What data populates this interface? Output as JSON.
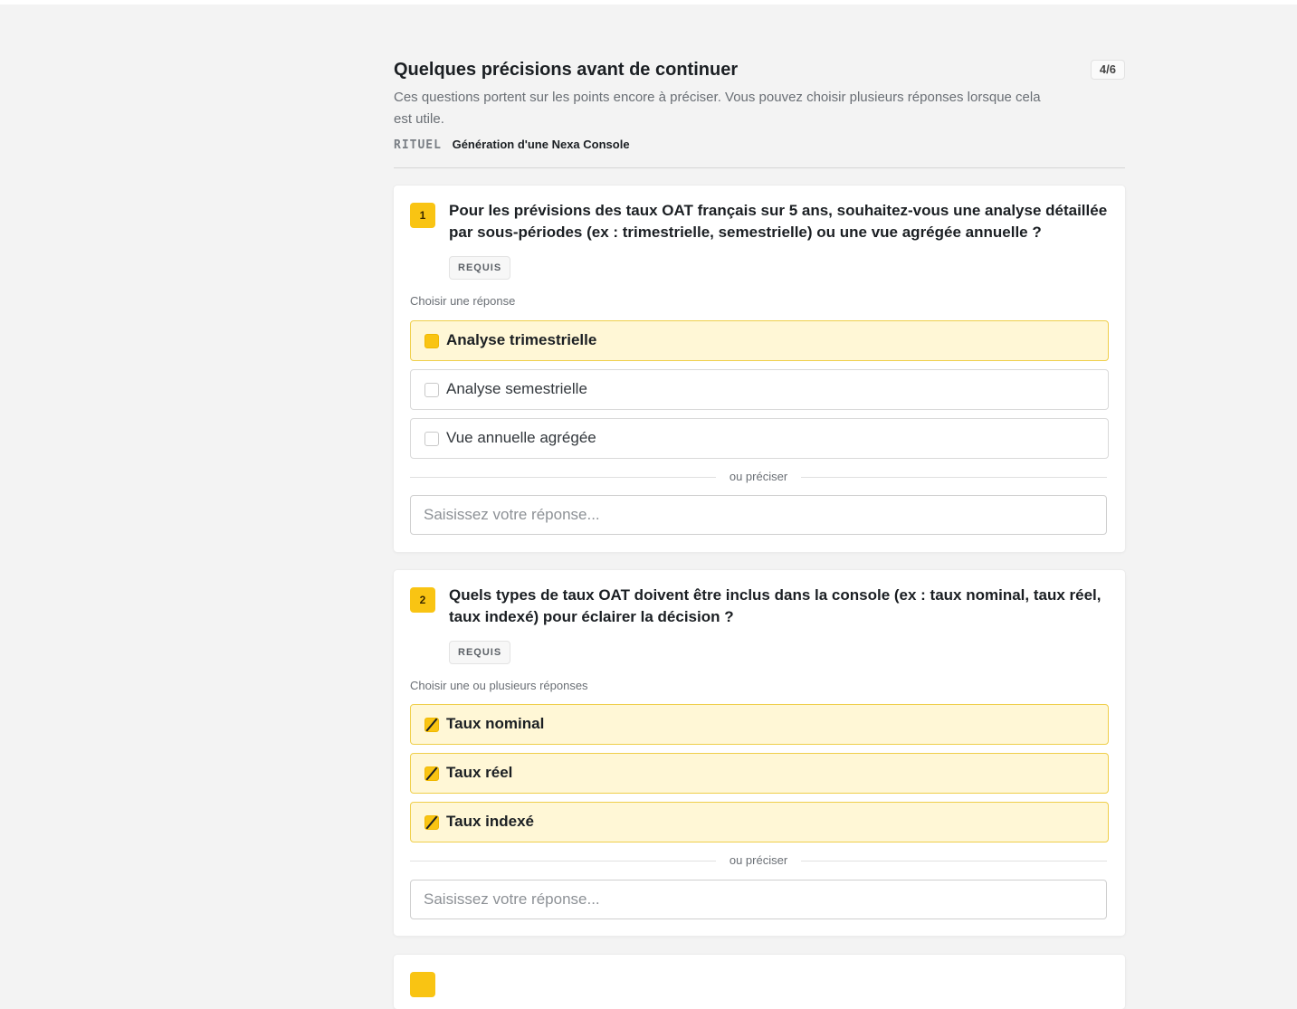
{
  "header": {
    "title": "Quelques précisions avant de continuer",
    "step": "4/6",
    "subtitle": "Ces questions portent sur les points encore à préciser. Vous pouvez choisir plusieurs réponses lorsque cela est utile.",
    "ritual_tag": "RITUEL",
    "ritual_name": "Génération d'une Nexa Console"
  },
  "questions": [
    {
      "number": "1",
      "text": "Pour les prévisions des taux OAT français sur 5 ans, souhaitez-vous une analyse détaillée par sous-périodes (ex : trimestrielle, semestrielle) ou une vue agrégée annuelle ?",
      "badge": "REQUIS",
      "hint": "Choisir une réponse",
      "options": [
        {
          "label": "Analyse trimestrielle",
          "selected": true
        },
        {
          "label": "Analyse semestrielle",
          "selected": false
        },
        {
          "label": "Vue annuelle agrégée",
          "selected": false
        }
      ],
      "or_label": "ou préciser",
      "input_placeholder": "Saisissez votre réponse..."
    },
    {
      "number": "2",
      "text": "Quels types de taux OAT doivent être inclus dans la console (ex : taux nominal, taux réel, taux indexé) pour éclairer la décision ?",
      "badge": "REQUIS",
      "hint": "Choisir une ou plusieurs réponses",
      "options": [
        {
          "label": "Taux nominal",
          "selected": true
        },
        {
          "label": "Taux réel",
          "selected": true
        },
        {
          "label": "Taux indexé",
          "selected": true
        }
      ],
      "or_label": "ou préciser",
      "input_placeholder": "Saisissez votre réponse..."
    }
  ],
  "colors": {
    "accent": "#f9c413",
    "selected_bg": "#fff7d6",
    "selected_border": "#efcf4b",
    "page_bg": "#f3f3f3"
  }
}
